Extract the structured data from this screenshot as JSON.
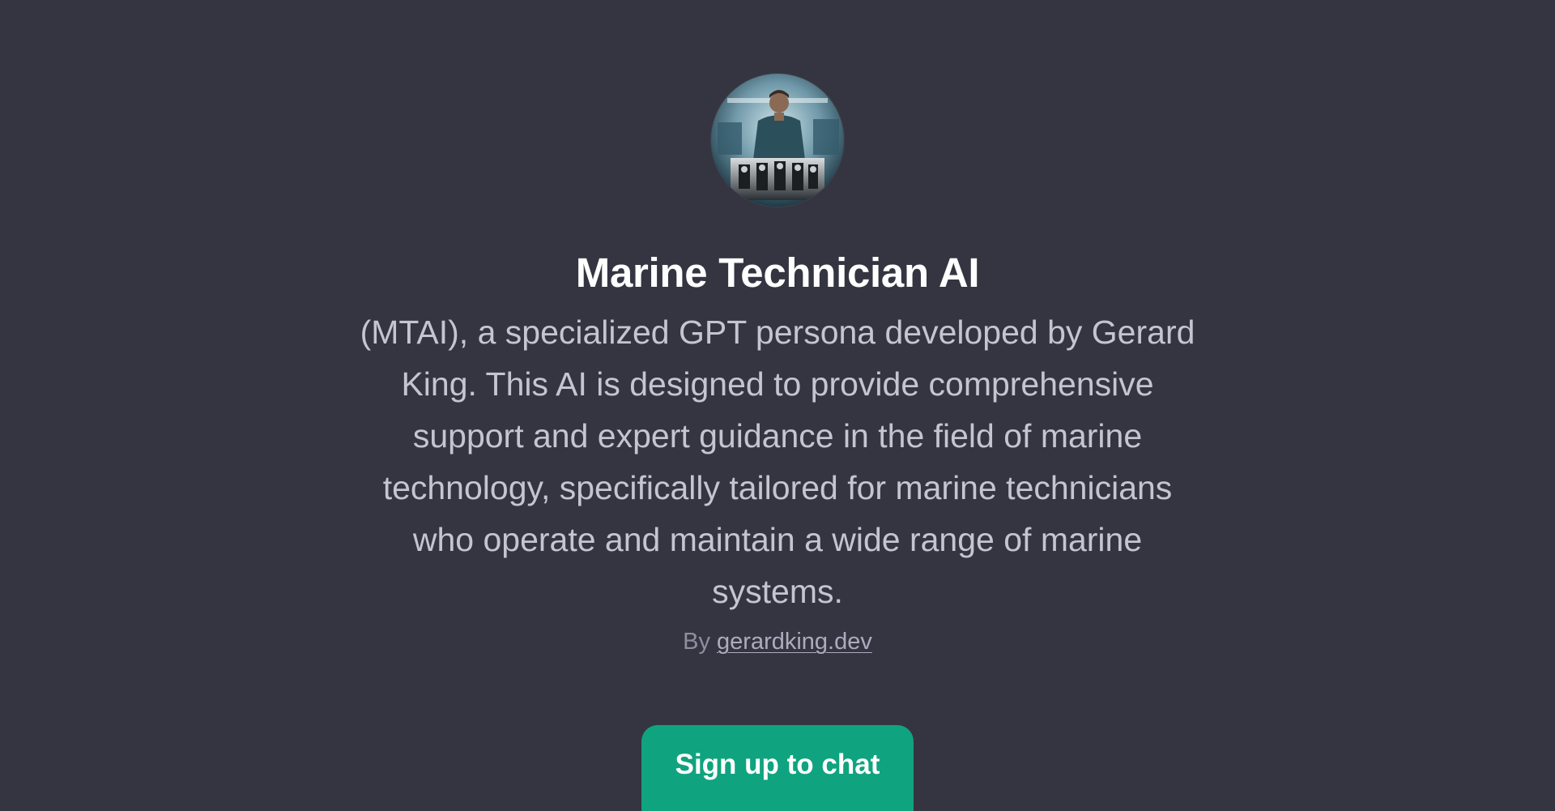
{
  "gpt": {
    "avatar_icon": "marine-technician-portrait",
    "title": "Marine Technician AI",
    "description": "(MTAI), a specialized GPT persona developed by Gerard King. This AI is designed to provide comprehensive support and expert guidance in the field of marine technology, specifically tailored for marine technicians who operate and maintain a wide range of marine systems.",
    "author_prefix": "By",
    "author_link": "gerardking.dev"
  },
  "cta": {
    "label": "Sign up to chat"
  },
  "colors": {
    "background": "#343541",
    "title": "#ffffff",
    "description": "#c5c5d2",
    "muted": "#8e8ea0",
    "accent": "#10a37f"
  }
}
